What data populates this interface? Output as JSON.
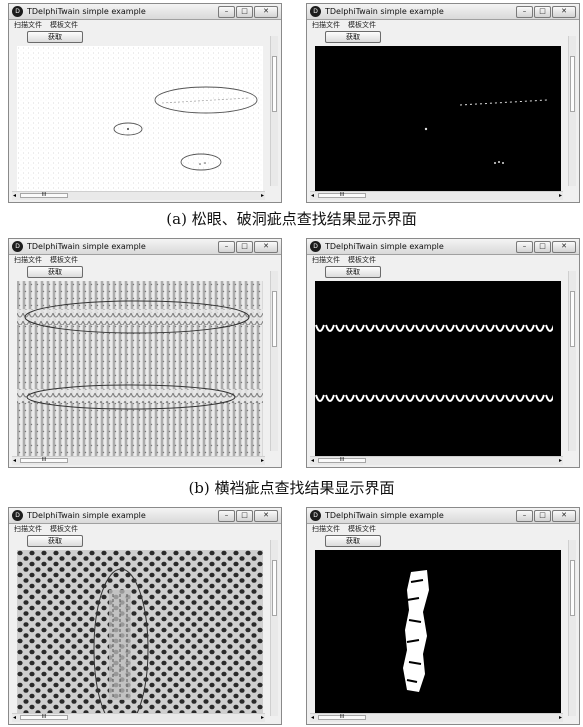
{
  "window": {
    "title": "TDelphiTwain simple example",
    "menu": [
      "扫描文件",
      "模板文件"
    ],
    "acquire_label": "获取",
    "scroll_glyph": "III",
    "icon_letter": "D"
  },
  "captions": {
    "a": "(a) 松眼、破洞疵点查找结果显示界面",
    "b": "(b) 横裆疵点查找结果显示界面"
  },
  "colors": {
    "result_bg": "#000000",
    "marker": "#555555"
  }
}
